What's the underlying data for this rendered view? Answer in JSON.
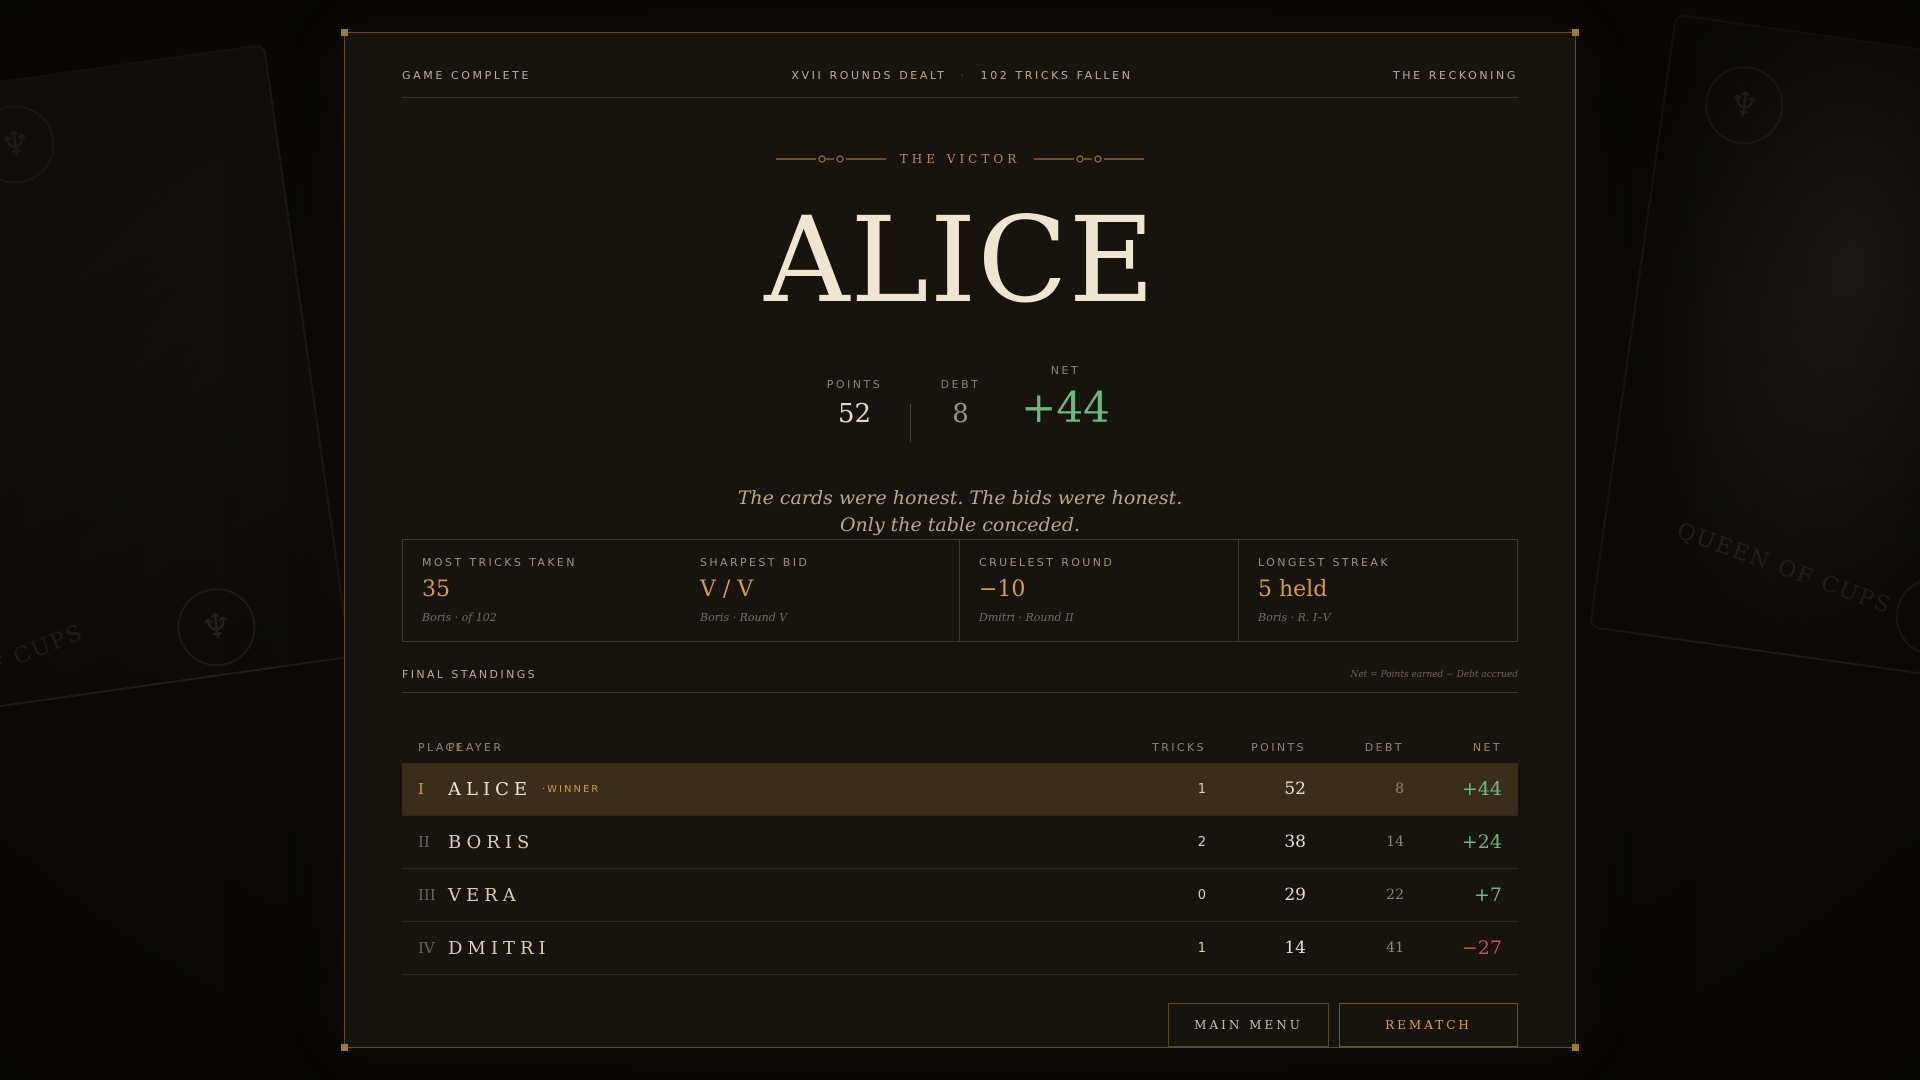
{
  "header": {
    "left": "GAME COMPLETE",
    "rounds": "XVII ROUNDS DEALT",
    "separator": "·",
    "tricks": "102 TRICKS FALLEN",
    "right": "THE RECKONING"
  },
  "victor": {
    "label": "THE VICTOR",
    "name": "ALICE",
    "points_label": "POINTS",
    "points": "52",
    "debt_label": "DEBT",
    "debt": "8",
    "net_label": "NET",
    "net": "+44"
  },
  "quote": "The cards were honest. The bids were honest. Only the table conceded.",
  "stats": [
    {
      "label": "MOST TRICKS TAKEN",
      "value": "35",
      "sub": "Boris · of 102"
    },
    {
      "label": "SHARPEST BID",
      "value": "V / V",
      "sub": "Boris · Round V"
    },
    {
      "label": "CRUELEST ROUND",
      "value": "−10",
      "sub": "Dmitri · Round II"
    },
    {
      "label": "LONGEST STREAK",
      "value": "5 held",
      "sub": "Boris · R. I–V"
    }
  ],
  "standings": {
    "title": "FINAL STANDINGS",
    "legend": "Net = Points earned − Debt accrued",
    "columns": {
      "place": "PLACE",
      "player": "PLAYER",
      "tricks": "TRICKS",
      "points": "POINTS",
      "debt": "DEBT",
      "net": "NET"
    },
    "winner_tag": "·WINNER",
    "rows": [
      {
        "place": "I",
        "player": "ALICE",
        "tricks": "1",
        "points": "52",
        "debt": "8",
        "net": "+44"
      },
      {
        "place": "II",
        "player": "BORIS",
        "tricks": "2",
        "points": "38",
        "debt": "14",
        "net": "+24"
      },
      {
        "place": "III",
        "player": "VERA",
        "tricks": "0",
        "points": "29",
        "debt": "22",
        "net": "+7"
      },
      {
        "place": "IV",
        "player": "DMITRI",
        "tricks": "1",
        "points": "14",
        "debt": "41",
        "net": "−27"
      }
    ]
  },
  "buttons": {
    "main_menu": "MAIN MENU",
    "rematch": "REMATCH"
  },
  "background_cards": {
    "left_name": "G OF CUPS",
    "right_name": "QUEEN OF CUPS"
  },
  "colors": {
    "accent": "#c99a4c",
    "positive": "#6fb57f",
    "negative": "#c2574a",
    "panel": "#17130e"
  }
}
